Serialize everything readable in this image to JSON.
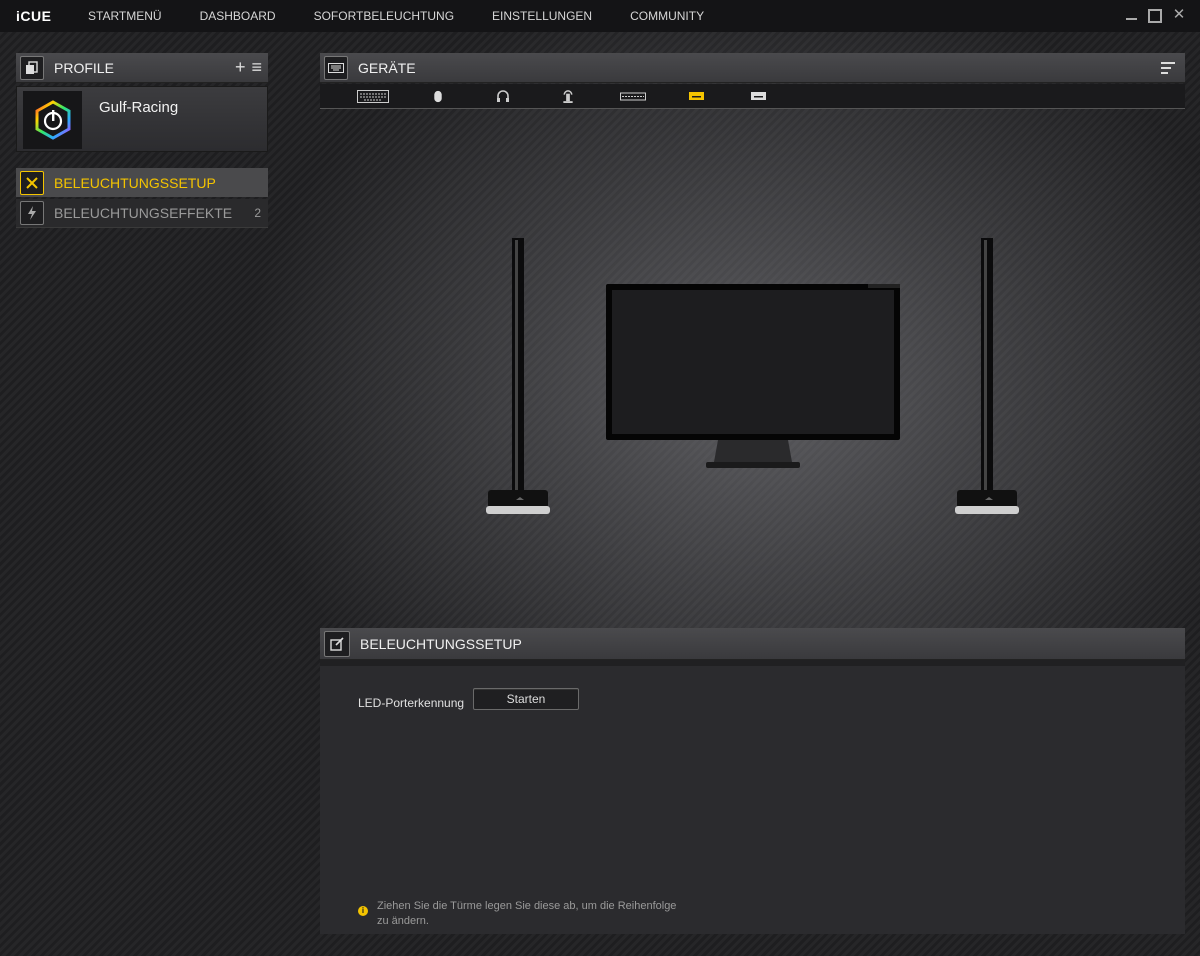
{
  "app": {
    "logo": "iCUE",
    "nav": [
      "STARTMENÜ",
      "DASHBOARD",
      "SOFORTBELEUCHTUNG",
      "EINSTELLUNGEN",
      "COMMUNITY"
    ],
    "window_controls": {
      "close": "✕"
    }
  },
  "profiles": {
    "title": "PROFILE",
    "add_icon": "+",
    "menu_icon": "≡",
    "current": {
      "name": "Gulf-Racing",
      "icon": "icue-hexagon-logo"
    }
  },
  "sidebar_menu": [
    {
      "label": "BELEUCHTUNGSSETUP",
      "icon": "tools-icon",
      "active": true
    },
    {
      "label": "BELEUCHTUNGSEFFEKTE",
      "icon": "lightning-icon",
      "count": "2",
      "active": false
    }
  ],
  "devices": {
    "title": "GERÄTE",
    "tabs": [
      "keyboard-icon",
      "mouse-icon",
      "headset-icon",
      "headset-stand-icon",
      "keyboard-slim-icon",
      "lightbar-icon",
      "device-small-icon"
    ],
    "active_tab_index": 5,
    "active_color": "#f4c400"
  },
  "setup": {
    "title": "BELEUCHTUNGSSETUP",
    "led_label": "LED-Porterkennung",
    "start_button": "Starten",
    "hint_icon": "i",
    "hint": "Ziehen Sie die Türme legen Sie diese ab, um die Reihenfolge zu ändern."
  },
  "colors": {
    "accent": "#f4c400",
    "background": "#1c1c1e",
    "panel_header": "#3e3e41"
  }
}
